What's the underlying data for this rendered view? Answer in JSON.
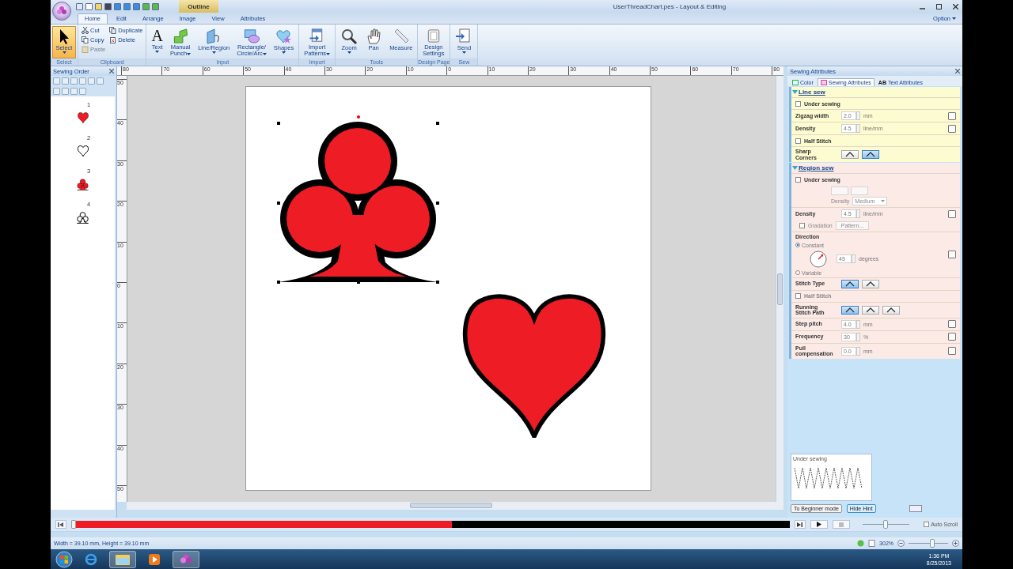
{
  "window": {
    "title": "UserThreadChart.pes - Layout & Editing",
    "context_tab": "Outline"
  },
  "menu_tabs": [
    {
      "label": "Home",
      "selected": true
    },
    {
      "label": "Edit",
      "selected": false
    },
    {
      "label": "Arrange",
      "selected": false
    },
    {
      "label": "Image",
      "selected": false
    },
    {
      "label": "View",
      "selected": false
    },
    {
      "label": "Attributes",
      "selected": false
    }
  ],
  "option_menu": "Option",
  "ribbon": [
    {
      "group": "Select",
      "items": [
        {
          "label": "Select",
          "kind": "large",
          "selected": true,
          "dropdown": true
        }
      ]
    },
    {
      "group": "Clipboard",
      "items": [
        {
          "label": "Cut",
          "kind": "small",
          "disabled": false
        },
        {
          "label": "Copy",
          "kind": "small",
          "disabled": false
        },
        {
          "label": "Paste",
          "kind": "small",
          "disabled": true
        },
        {
          "label": "Duplicate",
          "kind": "small",
          "disabled": false
        },
        {
          "label": "Delete",
          "kind": "small",
          "disabled": false
        }
      ]
    },
    {
      "group": "Input",
      "items": [
        {
          "label": "Text",
          "kind": "glyph",
          "glyph": "A",
          "dropdown": true
        },
        {
          "label": "Manual\nPunch",
          "kind": "large",
          "dropdown": true
        },
        {
          "label": "Line/Region",
          "kind": "large",
          "dropdown": true
        },
        {
          "label": "Rectangle/\nCircle/Arc",
          "kind": "large",
          "dropdown": true
        },
        {
          "label": "Shapes",
          "kind": "large",
          "dropdown": true
        }
      ]
    },
    {
      "group": "Import",
      "items": [
        {
          "label": "Import\nPatterns",
          "kind": "large",
          "dropdown": true
        }
      ]
    },
    {
      "group": "Tools",
      "items": [
        {
          "label": "Zoom",
          "kind": "large",
          "dropdown": true
        },
        {
          "label": "Pan",
          "kind": "large",
          "dropdown": false
        },
        {
          "label": "Measure",
          "kind": "large",
          "dropdown": false
        }
      ]
    },
    {
      "group": "Design Page",
      "items": [
        {
          "label": "Design\nSettings",
          "kind": "large",
          "dropdown": false
        }
      ]
    },
    {
      "group": "Sew",
      "items": [
        {
          "label": "Send",
          "kind": "large",
          "dropdown": true
        }
      ]
    }
  ],
  "sewing_order": {
    "title": "Sewing Order",
    "items": [
      {
        "number": "1",
        "kind": "heart",
        "filled": true
      },
      {
        "number": "2",
        "kind": "heart",
        "filled": false
      },
      {
        "number": "3",
        "kind": "club",
        "filled": true
      },
      {
        "number": "4",
        "kind": "club",
        "filled": false
      }
    ]
  },
  "top_ruler": [
    "80",
    "70",
    "60",
    "50",
    "40",
    "30",
    "20",
    "10",
    "0",
    "10",
    "20",
    "30",
    "40",
    "50",
    "60",
    "70",
    "80"
  ],
  "side_ruler": [
    "50",
    "40",
    "30",
    "20",
    "10",
    "0",
    "10",
    "20",
    "30",
    "40",
    "50"
  ],
  "canvas": {
    "shapes": [
      {
        "kind": "club",
        "selected": true
      },
      {
        "kind": "heart",
        "selected": false
      }
    ]
  },
  "sewing_attributes": {
    "title": "Sewing Attributes",
    "tabs": [
      {
        "label": "Color",
        "selected": false
      },
      {
        "label": "Sewing Attributes",
        "selected": true
      },
      {
        "label": "Text Attributes",
        "icon_text": "AB",
        "selected": false
      }
    ],
    "sections": [
      {
        "title": "Line sew",
        "expanded": true,
        "color": "#fdfbd0",
        "rows": [
          {
            "kind": "check",
            "label": "Under sewing",
            "checked": false,
            "disabled": false
          },
          {
            "kind": "number",
            "label": "Zigzag width",
            "value": "2.0",
            "unit": "mm"
          },
          {
            "kind": "number",
            "label": "Density",
            "value": "4.5",
            "unit": "line/mm"
          },
          {
            "kind": "check",
            "label": "Half Stitch",
            "checked": false,
            "disabled": false
          },
          {
            "kind": "buttons",
            "label": "Sharp\nCorners",
            "options": [
              {
                "selected": false
              },
              {
                "selected": true
              }
            ]
          }
        ]
      },
      {
        "title": "Region sew",
        "expanded": true,
        "color": "#fbeae6",
        "rows": [
          {
            "kind": "check",
            "label": "Under sewing",
            "checked": false,
            "disabled": false
          },
          {
            "kind": "sub_options",
            "label": "Density",
            "value": "Medium"
          },
          {
            "kind": "number",
            "label": "Density",
            "value": "4.5",
            "unit": "line/mm"
          },
          {
            "kind": "gradation",
            "label": "Gradation",
            "checked": false,
            "button": "Pattern..."
          },
          {
            "kind": "direction",
            "label": "Direction",
            "options": [
              {
                "label": "Constant",
                "selected": true
              },
              {
                "label": "Variable",
                "selected": false
              }
            ],
            "value": "45",
            "unit": "degrees"
          },
          {
            "kind": "buttons",
            "label": "Stitch Type",
            "options": [
              {
                "selected": true
              },
              {
                "selected": false
              }
            ]
          },
          {
            "kind": "check",
            "label": "Half Stitch",
            "checked": false,
            "disabled": true
          },
          {
            "kind": "buttons",
            "label": "Running\nStitch Path",
            "options": [
              {
                "selected": true
              },
              {
                "selected": false
              },
              {
                "selected": false
              }
            ]
          },
          {
            "kind": "number",
            "label": "Step pitch",
            "value": "4.0",
            "unit": "mm"
          },
          {
            "kind": "number",
            "label": "Frequency",
            "value": "30",
            "unit": "%"
          },
          {
            "kind": "number",
            "label": "Pull\ncompensation",
            "value": "0.0",
            "unit": "mm"
          }
        ]
      }
    ]
  },
  "hint": {
    "title": "Under sewing",
    "buttons": [
      "To Beginner mode",
      "Hide Hint"
    ]
  },
  "playback": {
    "level": 0.53,
    "speed": {
      "level": 0.5
    },
    "auto_scroll": {
      "label": "Auto Scroll",
      "checked": false
    }
  },
  "status_bar": {
    "text": "Width = 39.10 mm, Height = 39.10 mm",
    "zoom": "302%",
    "zoom_slider": {
      "level": 0.6
    }
  },
  "taskbar": {
    "time": "1:36 PM",
    "date": "8/25/2013"
  }
}
